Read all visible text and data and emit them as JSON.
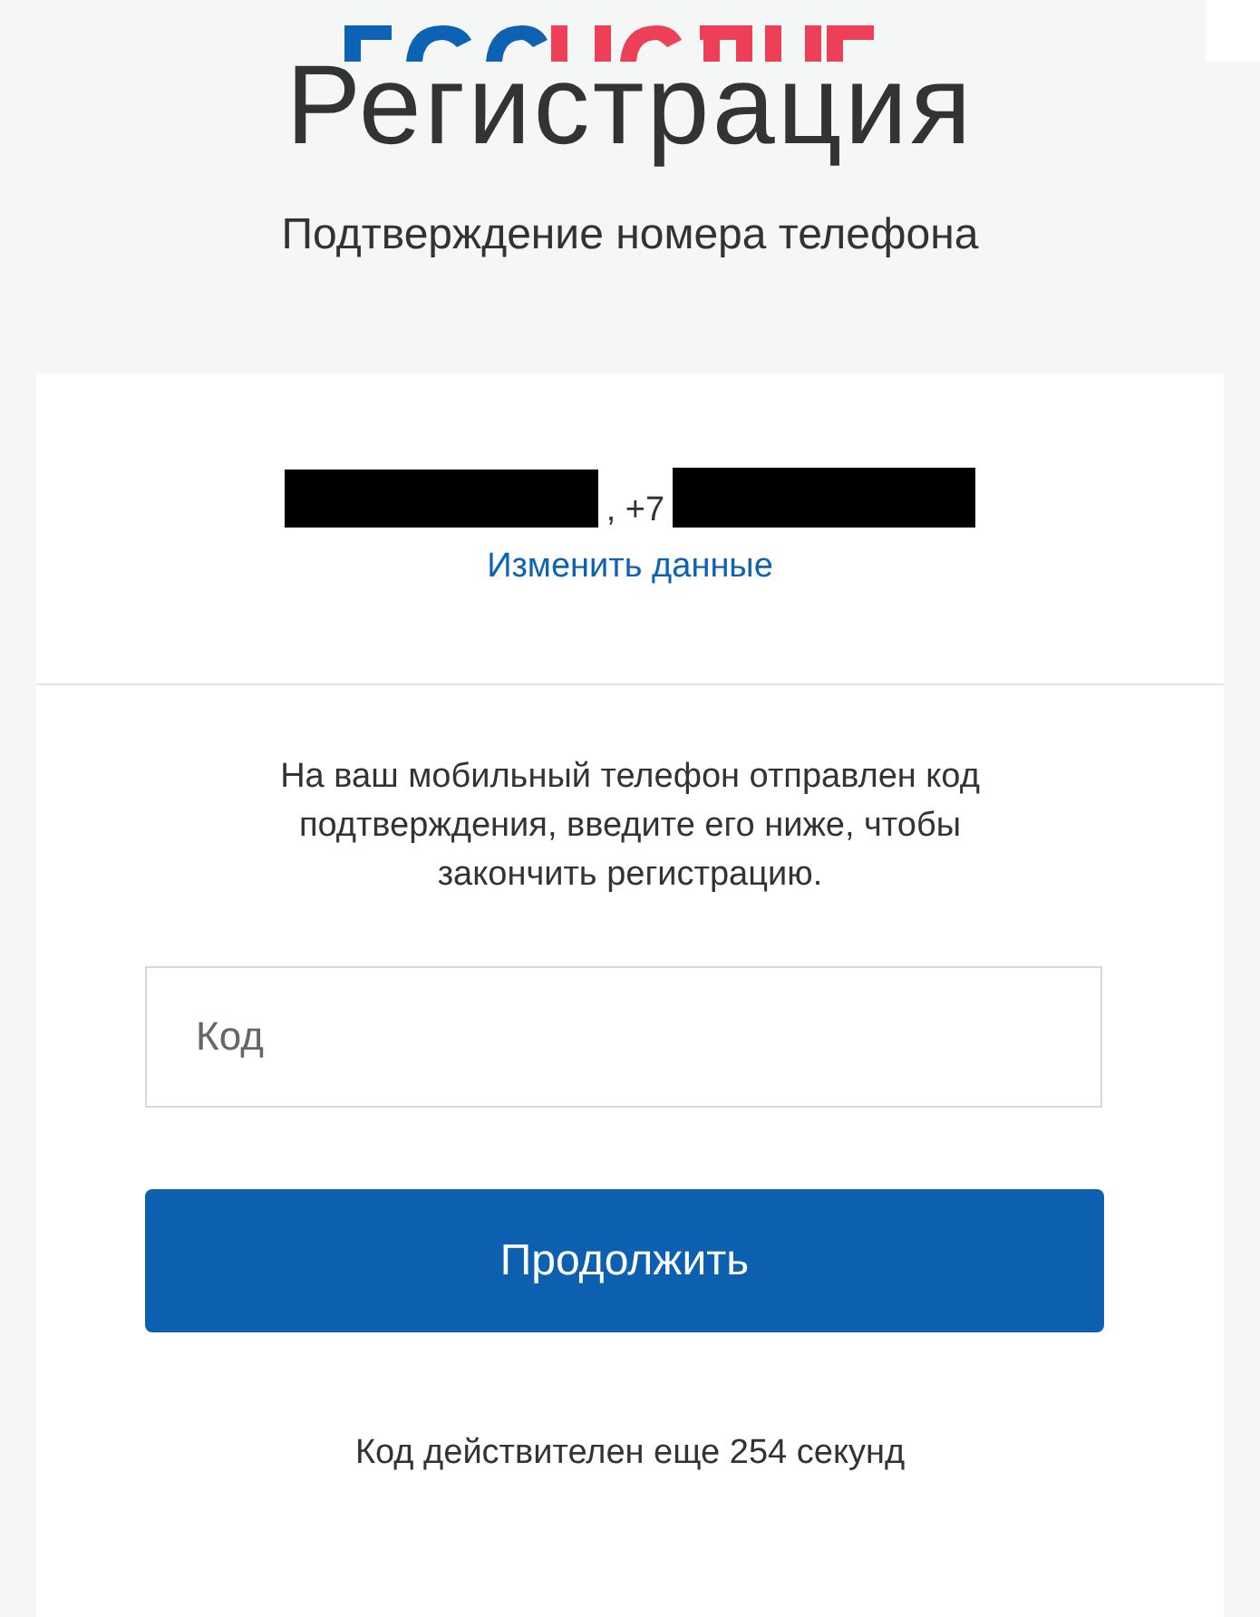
{
  "logo": {
    "parts": [
      {
        "color": "#0d62b4"
      },
      {
        "color": "#ee3f58"
      }
    ]
  },
  "title": "Регистрация",
  "subtitle": "Подтверждение номера телефона",
  "contact": {
    "separator": ", +7",
    "edit_link": "Изменить данные"
  },
  "message": "На ваш мобильный телефон отправлен код подтверждения, введите его ниже, чтобы закончить регистрацию.",
  "code_field": {
    "placeholder": "Код"
  },
  "continue_button": "Продолжить",
  "timer": "Код действителен еще 254 секунд"
}
